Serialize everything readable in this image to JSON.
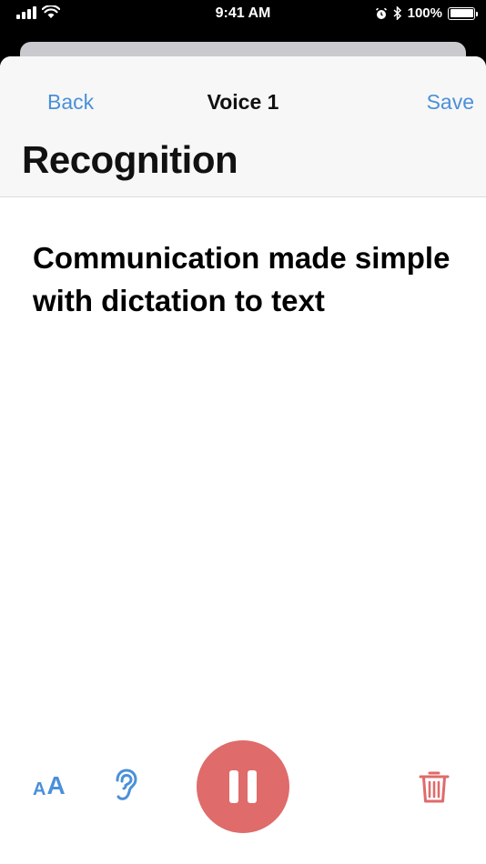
{
  "status_bar": {
    "time": "9:41 AM",
    "battery_percent": "100%",
    "battery_level": 1.0,
    "icons": [
      "signal-icon",
      "wifi-icon",
      "alarm-icon",
      "bluetooth-icon",
      "battery-icon"
    ]
  },
  "nav": {
    "back_label": "Back",
    "title": "Voice 1",
    "save_label": "Save",
    "large_title": "Recognition"
  },
  "transcript": {
    "text": "Communication made simple with dictation to text"
  },
  "toolbar": {
    "text_size_small": "A",
    "text_size_large": "A",
    "icons": [
      "text-size-icon",
      "hearing-icon",
      "pause-icon",
      "trash-icon"
    ]
  },
  "colors": {
    "accent": "#4a90d9",
    "record": "#df6b6b",
    "destructive": "#df6b6b"
  }
}
